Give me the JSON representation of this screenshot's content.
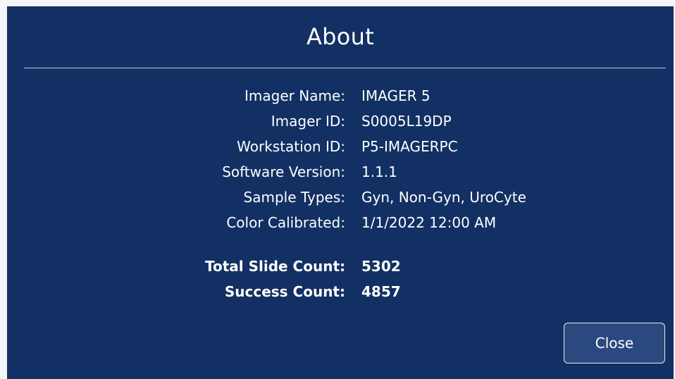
{
  "dialog": {
    "title": "About",
    "close_label": "Close"
  },
  "details": [
    {
      "label": "Imager Name:",
      "value": "IMAGER 5"
    },
    {
      "label": "Imager ID:",
      "value": "S0005L19DP"
    },
    {
      "label": "Workstation ID:",
      "value": "P5-IMAGERPC"
    },
    {
      "label": "Software Version:",
      "value": "1.1.1"
    },
    {
      "label": "Sample Types:",
      "value": "Gyn, Non-Gyn, UroCyte"
    },
    {
      "label": "Color Calibrated:",
      "value": "1/1/2022 12:00 AM"
    }
  ],
  "counts": [
    {
      "label": "Total Slide Count:",
      "value": "5302"
    },
    {
      "label": "Success Count:",
      "value": "4857"
    }
  ],
  "colors": {
    "dialog_background": "#123063",
    "button_background": "#2a4a7f",
    "text": "#ffffff"
  }
}
